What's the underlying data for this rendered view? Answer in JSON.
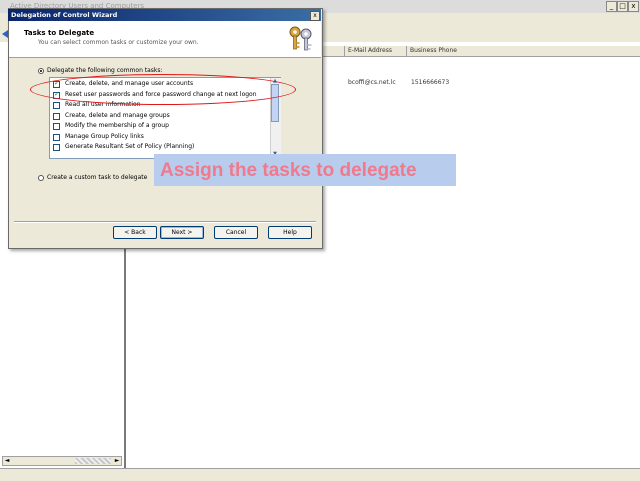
{
  "background_window": {
    "title": "Active Directory Users and Computers",
    "minimize_glyph": "_",
    "restore_glyph": "□",
    "close_glyph": "x",
    "columns": [
      "E-Mail Address",
      "Business Phone"
    ],
    "row": {
      "email": "bcoffi@cs.net.lc",
      "phone": "1516666673"
    },
    "scroll_left_glyph": "◄",
    "scroll_right_glyph": "►"
  },
  "wizard": {
    "title": "Delegation of Control Wizard",
    "close_glyph": "x",
    "heading": "Tasks to Delegate",
    "subheading": "You can select common tasks or customize your own.",
    "icon": "keys-icon",
    "radio_common_label": "Delegate the following common tasks:",
    "radio_custom_label": "Create a custom task to delegate",
    "tasks": [
      {
        "label": "Create, delete, and manage user accounts",
        "checked": true
      },
      {
        "label": "Reset user passwords and force password change at next logon",
        "checked": true
      },
      {
        "label": "Read all user information",
        "checked": false
      },
      {
        "label": "Create, delete and manage groups",
        "checked": false
      },
      {
        "label": "Modify the membership of a group",
        "checked": false
      },
      {
        "label": "Manage Group Policy links",
        "checked": false
      },
      {
        "label": "Generate Resultant Set of Policy (Planning)",
        "checked": false
      }
    ],
    "scroll_up_glyph": "▲",
    "scroll_down_glyph": "▼",
    "buttons": {
      "back": "< Back",
      "next": "Next >",
      "cancel": "Cancel",
      "help": "Help"
    }
  },
  "callout": {
    "text": "Assign the tasks to delegate"
  },
  "colors": {
    "highlight_ellipse": "#e01818",
    "callout_background": "#b8ccee",
    "callout_text": "#f07a8c",
    "titlebar": "#0a246a"
  }
}
